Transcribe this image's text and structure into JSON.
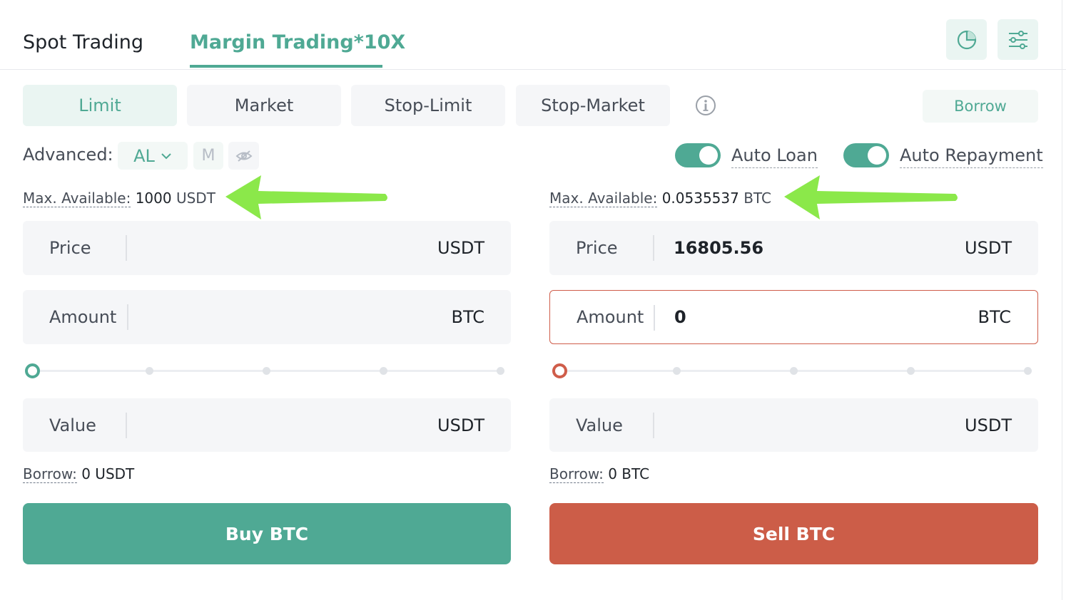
{
  "tabs": {
    "spot": "Spot Trading",
    "margin": "Margin Trading*10X"
  },
  "header_icons": [
    "pie-chart-icon",
    "sliders-icon"
  ],
  "order_types": [
    "Limit",
    "Market",
    "Stop-Limit",
    "Stop-Market"
  ],
  "active_order_type": "Limit",
  "borrow_button": "Borrow",
  "advanced": {
    "label": "Advanced:",
    "al": "AL",
    "m": "M"
  },
  "toggles": {
    "auto_loan": "Auto Loan",
    "auto_repayment": "Auto Repayment"
  },
  "buy": {
    "max_label": "Max. Available:",
    "max_value": "1000",
    "max_unit": "USDT",
    "price_label": "Price",
    "price_value": "",
    "price_unit": "USDT",
    "amount_label": "Amount",
    "amount_value": "",
    "amount_unit": "BTC",
    "slider_percent": 0,
    "value_label": "Value",
    "value_unit": "USDT",
    "borrow_label": "Borrow:",
    "borrow_value": "0 USDT",
    "button": "Buy BTC"
  },
  "sell": {
    "max_label": "Max. Available:",
    "max_value": "0.0535537",
    "max_unit": "BTC",
    "price_label": "Price",
    "price_value": "16805.56",
    "price_unit": "USDT",
    "amount_label": "Amount",
    "amount_value": "0",
    "amount_unit": "BTC",
    "slider_percent": 0,
    "value_label": "Value",
    "value_unit": "USDT",
    "borrow_label": "Borrow:",
    "borrow_value": "0 BTC",
    "button": "Sell BTC"
  },
  "colors": {
    "accent": "#4fa994",
    "sell": "#cc5d48",
    "annotation_arrow": "#8be84a"
  }
}
